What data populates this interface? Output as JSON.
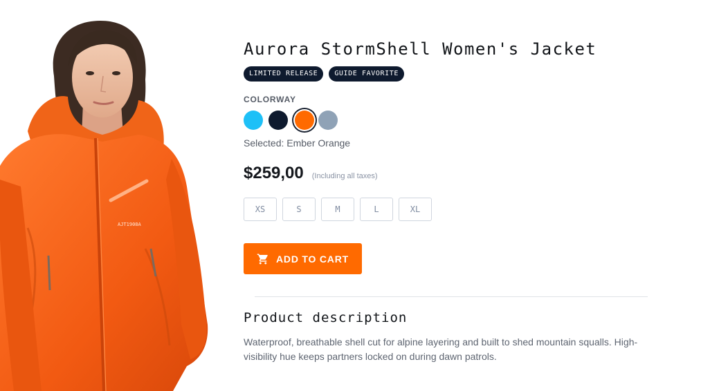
{
  "product": {
    "title": "Aurora StormShell Women's Jacket",
    "badges": [
      "LIMITED RELEASE",
      "GUIDE FAVORITE"
    ],
    "image_alt": "Woman wearing orange hooded shell jacket",
    "jacket_logo_text": "AJT1908A"
  },
  "colorway": {
    "label": "COLORWAY",
    "swatches": [
      {
        "name": "Sky Blue",
        "color": "#1ec0f7"
      },
      {
        "name": "Midnight",
        "color": "#0e1a2e"
      },
      {
        "name": "Ember Orange",
        "color": "#ff6a00",
        "selected": true
      },
      {
        "name": "Slate",
        "color": "#8fa2b6"
      }
    ],
    "selected_text": "Selected: Ember Orange"
  },
  "pricing": {
    "price": "$259,00",
    "tax_note": "(Including all taxes)"
  },
  "sizes": [
    "XS",
    "S",
    "M",
    "L",
    "XL"
  ],
  "cart": {
    "label": "ADD TO CART",
    "icon": "cart-icon",
    "color": "#ff6a00"
  },
  "description": {
    "title": "Product description",
    "text": "Waterproof, breathable shell cut for alpine layering and built to shed mountain squalls. High-visibility hue keeps partners locked on during dawn patrols."
  }
}
